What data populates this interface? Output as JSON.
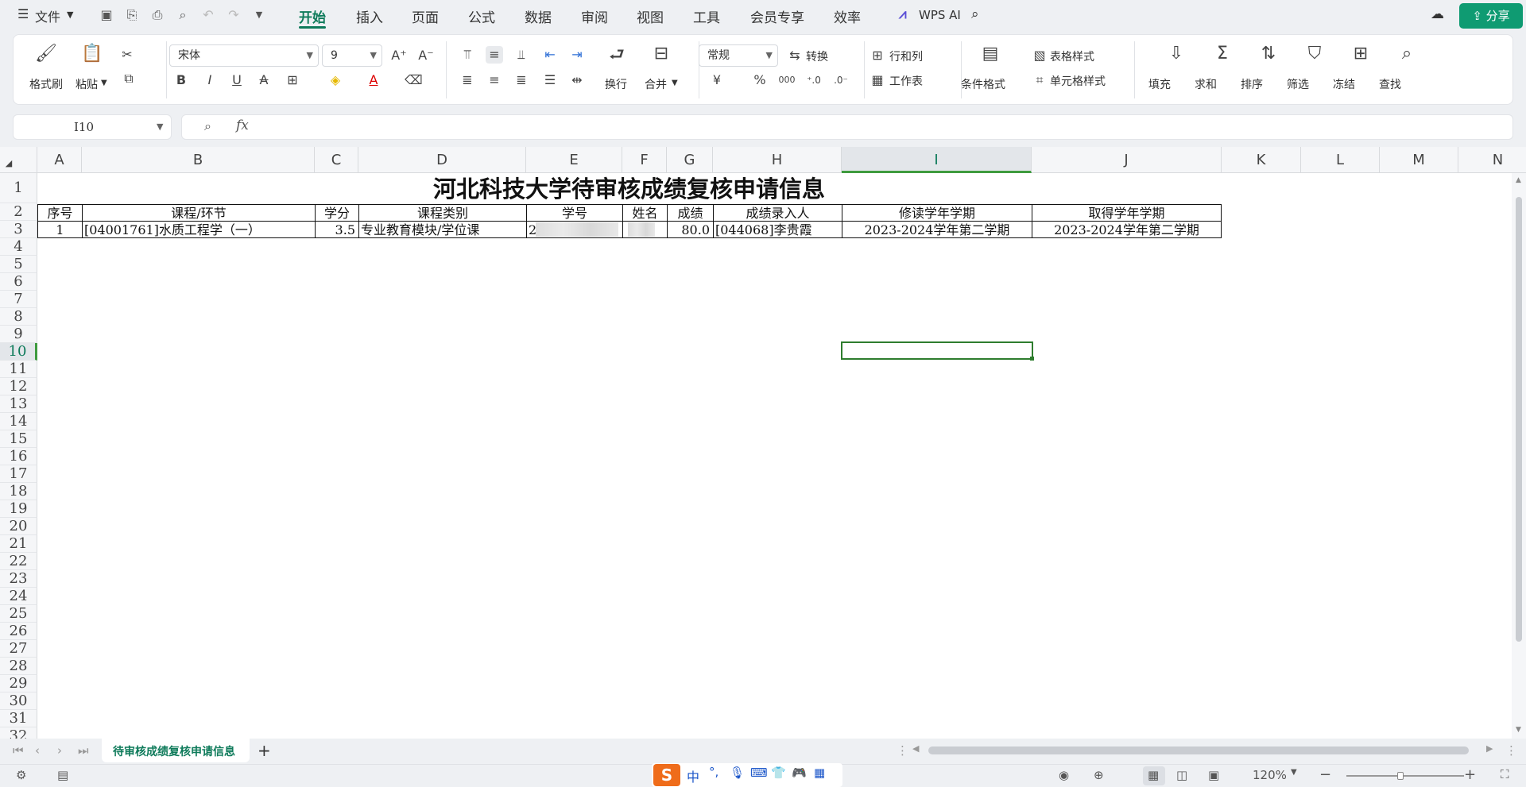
{
  "menu": {
    "file_label": "文件",
    "tabs": [
      "开始",
      "插入",
      "页面",
      "公式",
      "数据",
      "审阅",
      "视图",
      "工具",
      "会员专享",
      "效率"
    ],
    "wps_ai": "WPS AI",
    "share": "分享"
  },
  "ribbon": {
    "format_painter": "格式刷",
    "paste": "粘贴",
    "font_name": "宋体",
    "font_size": "9",
    "wrap": "换行",
    "merge": "合并",
    "number_format": "常规",
    "convert": "转换",
    "row_col": "行和列",
    "worksheet": "工作表",
    "cond_format": "条件格式",
    "table_style": "表格样式",
    "cell_style": "单元格样式",
    "fill": "填充",
    "sum": "求和",
    "sort": "排序",
    "filter": "筛选",
    "freeze": "冻结",
    "find": "查找",
    "currency_symbol": "¥",
    "percent_symbol": "%",
    "thousands_symbol": "000"
  },
  "formula_bar": {
    "name_box": "I10",
    "fx": "fx",
    "value": ""
  },
  "columns": [
    "A",
    "B",
    "C",
    "D",
    "E",
    "F",
    "G",
    "H",
    "I",
    "J",
    "K",
    "L",
    "M",
    "N"
  ],
  "rows": [
    "1",
    "2",
    "3",
    "4",
    "5",
    "6",
    "7",
    "8",
    "9",
    "10",
    "11",
    "12",
    "13",
    "14",
    "15",
    "16",
    "17",
    "18",
    "19",
    "20",
    "21",
    "22",
    "23",
    "24",
    "25",
    "26",
    "27",
    "28",
    "29",
    "30",
    "31",
    "32"
  ],
  "sheet": {
    "title": "河北科技大学待审核成绩复核申请信息",
    "headers": [
      "序号",
      "课程/环节",
      "学分",
      "课程类别",
      "学号",
      "姓名",
      "成绩",
      "成绩录入人",
      "修读学年学期",
      "取得学年学期"
    ],
    "row1": [
      "1",
      "[04001761]水质工程学（一）",
      "3.5",
      "专业教育模块/学位课",
      "2",
      "",
      "80.0",
      "[044068]李贵霞",
      "2023-2024学年第二学期",
      "2023-2024学年第二学期"
    ]
  },
  "tabs": {
    "sheet_name": "待审核成绩复核申请信息",
    "add": "+"
  },
  "status": {
    "zoom": "120%",
    "ime": "中"
  }
}
